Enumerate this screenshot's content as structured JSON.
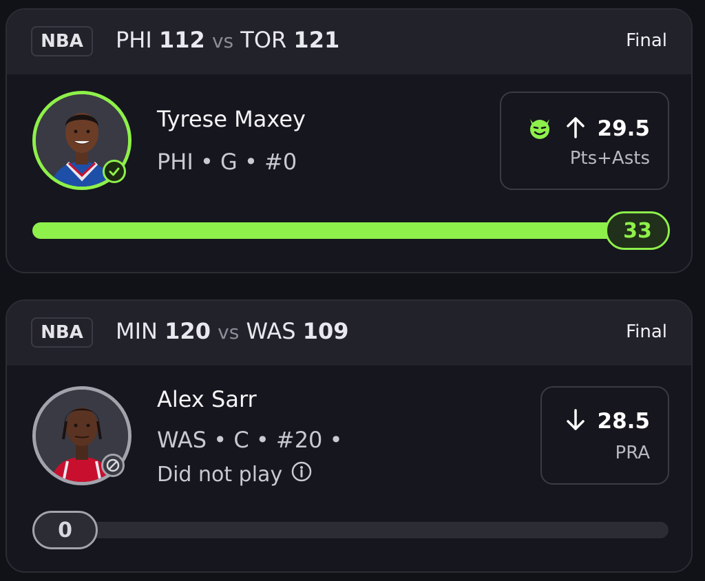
{
  "colors": {
    "background": "#111118",
    "card": "#16161e",
    "header": "#22222b",
    "accent_green": "#8ef04a",
    "muted_gray": "#a3a3ac"
  },
  "cards": [
    {
      "league": "NBA",
      "matchup": {
        "team1": "PHI",
        "score1": "112",
        "vs": "vs",
        "team2": "TOR",
        "score2": "121"
      },
      "status": "Final",
      "player": {
        "name": "Tyrese Maxey",
        "meta": "PHI • G • #0",
        "status_icon": "check-circle-icon"
      },
      "line": {
        "direction_icon": "arrow-up-icon",
        "badge_icon": "devil-smile-icon",
        "value": "29.5",
        "stat": "Pts+Asts"
      },
      "result": {
        "value": "33",
        "progress_fraction": 1.0
      }
    },
    {
      "league": "NBA",
      "matchup": {
        "team1": "MIN",
        "score1": "120",
        "vs": "vs",
        "team2": "WAS",
        "score2": "109"
      },
      "status": "Final",
      "player": {
        "name": "Alex Sarr",
        "meta": "WAS • C • #20 •",
        "note": "Did not play",
        "note_icon": "info-icon",
        "status_icon": "blocked-icon"
      },
      "line": {
        "direction_icon": "arrow-down-icon",
        "value": "28.5",
        "stat": "PRA"
      },
      "result": {
        "value": "0",
        "progress_fraction": 0.0
      }
    }
  ]
}
